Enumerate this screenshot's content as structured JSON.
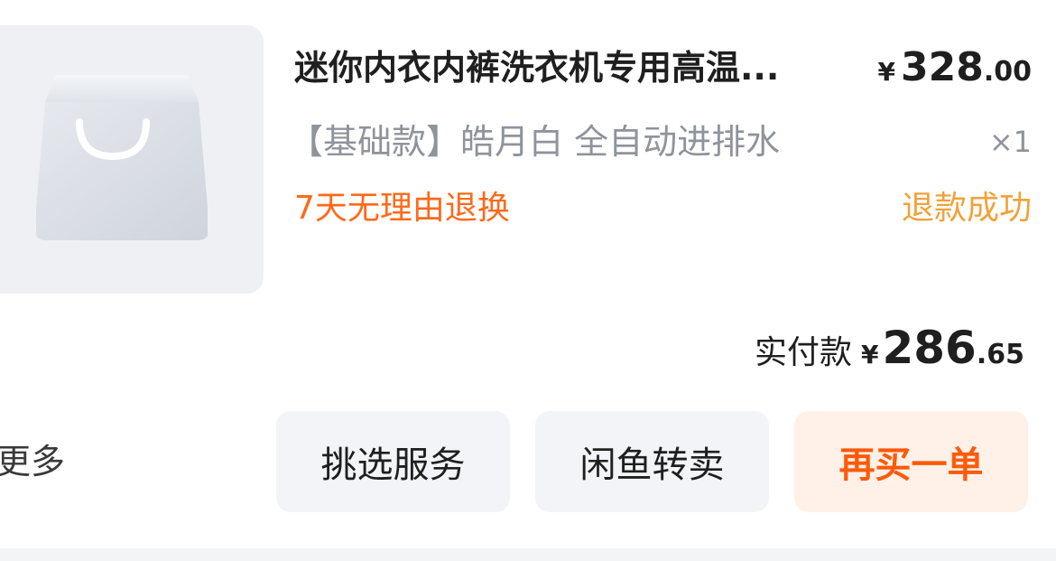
{
  "product": {
    "title": "迷你内衣内裤洗衣机专用高温...",
    "price_currency": "¥",
    "price_integer": "328",
    "price_decimal": ".00",
    "spec": "【基础款】皓月白 全自动进排水",
    "quantity": "×1",
    "tag": "7天无理由退换",
    "status": "退款成功",
    "image_icon": "shopping-bag-icon"
  },
  "payment": {
    "label": "实付款",
    "currency": "¥",
    "integer": "286",
    "decimal": ".65"
  },
  "actions": {
    "more_label": "更多",
    "buttons": [
      {
        "label": "挑选服务"
      },
      {
        "label": "闲鱼转卖"
      },
      {
        "label": "再买一单"
      }
    ]
  },
  "colors": {
    "accent": "#ff5a0a",
    "accent_bg": "#fff1e8",
    "status": "#f0a23a",
    "secondary_text": "#8f939b",
    "button_bg": "#f2f4f7"
  }
}
